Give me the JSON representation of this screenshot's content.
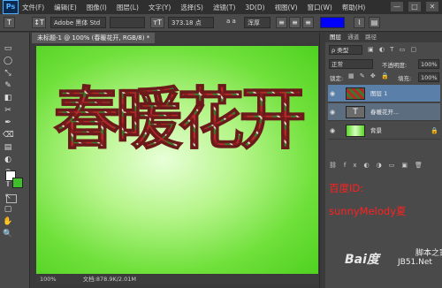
{
  "app": {
    "logo": "Ps",
    "window_buttons": [
      "—",
      "□",
      "✕"
    ]
  },
  "menu": [
    "文件(F)",
    "编辑(E)",
    "图像(I)",
    "图层(L)",
    "文字(Y)",
    "选择(S)",
    "滤镜(T)",
    "3D(D)",
    "视图(V)",
    "窗口(W)",
    "帮助(H)"
  ],
  "options": {
    "tool_icon": "T",
    "orientation_icon": "↕T",
    "font_family": "Adobe 黑体 Std",
    "font_style": "",
    "size_icon": "ᴛT",
    "font_size": "373.18 点",
    "aa_label": "a a",
    "antialias": "浑厚",
    "color_hex": "#0000ff"
  },
  "document": {
    "tab_title": "未标题-1 @ 100% (春暖花开, RGB/8) *",
    "canvas_text": "春暖花开",
    "zoom": "100%",
    "doc_info": "文档:878.9K/2.01M"
  },
  "tools": [
    "▭",
    "◯",
    "⤡",
    "✎",
    "◧",
    "✂",
    "✒",
    "⌫",
    "▤",
    "◐",
    "⊕",
    "T",
    "↖",
    "▢",
    "✋",
    "🔍"
  ],
  "layers_panel": {
    "tabs": [
      "图层",
      "通道",
      "路径"
    ],
    "kind_label": "ρ 类型",
    "blend_mode": "正常",
    "opacity_label": "不透明度:",
    "opacity_value": "100%",
    "lock_label": "锁定:",
    "fill_label": "填充:",
    "fill_value": "100%",
    "layers": [
      {
        "name": "图层 1",
        "type": "image",
        "selected": true
      },
      {
        "name": "春暖花开...",
        "type": "text",
        "selected": false
      },
      {
        "name": "背景",
        "type": "background",
        "selected": false
      }
    ],
    "footer_icons": [
      "⛓",
      "fx",
      "◐",
      "◑",
      "▭",
      "▣",
      "🗑"
    ]
  },
  "watermark": {
    "line1": "百度ID:",
    "line2": "sunnyMelody夏"
  },
  "site_watermark": {
    "logo_text": "Bai度",
    "line1": "脚本之家",
    "line2": "JB51.Net"
  },
  "colors": {
    "accent": "#0000ff",
    "selected_layer": "#5a7fa8",
    "canvas_green": "#5ad426",
    "watermark_red": "#ff2020"
  }
}
